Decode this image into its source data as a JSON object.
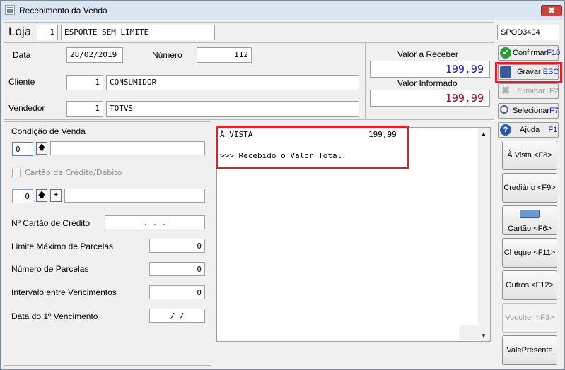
{
  "window": {
    "title": "Recebimento da Venda",
    "close": "✖"
  },
  "loja": {
    "label": "Loja",
    "code": "1",
    "name": "ESPORTE SEM LIMITE"
  },
  "terminal": "SPOD3404",
  "header": {
    "data_label": "Data",
    "data_value": "28/02/2019",
    "numero_label": "Número",
    "numero_value": "112",
    "cliente_label": "Cliente",
    "cliente_code": "1",
    "cliente_name": "CONSUMIDOR",
    "vendedor_label": "Vendedor",
    "vendedor_code": "1",
    "vendedor_name": "TOTVS"
  },
  "values": {
    "receber_label": "Valor a Receber",
    "receber_value": "199,99",
    "informado_label": "Valor Informado",
    "informado_value": "199,99"
  },
  "left": {
    "condicao_label": "Condição de Venda",
    "condicao_code": "0",
    "cartao_label": "Cartão de Crédito/Débito",
    "cartao_code": "0",
    "num_cartao_label": "Nº Cartão de Crédito",
    "num_cartao_value": ".   .   .",
    "limite_label": "Limite Máximo de Parcelas",
    "limite_value": "0",
    "parcelas_label": "Número de Parcelas",
    "parcelas_value": "0",
    "intervalo_label": "Intervalo entre Vencimentos",
    "intervalo_value": "0",
    "vencimento_label": "Data do 1º Vencimento",
    "vencimento_value": "/   /"
  },
  "memo": {
    "line1_label": "À VISTA",
    "line1_value": "199,99",
    "line2": ">>> Recebido o Valor Total."
  },
  "side": {
    "confirmar": "Confirmar",
    "confirmar_key": "F10",
    "gravar": "Gravar",
    "gravar_key": "ESC",
    "eliminar": "Eliminar",
    "eliminar_key": "F2",
    "selecionar": "Selecionar",
    "selecionar_key": "F7",
    "ajuda": "Ajuda",
    "ajuda_key": "F1",
    "avista": "À Vista <F8>",
    "crediario": "Crediário <F9>",
    "cartao": "Cartão <F6>",
    "cheque": "Cheque <F11>",
    "outros": "Outros <F12>",
    "voucher": "Voucher <F3>",
    "vale": "ValePresente"
  },
  "colors": {
    "value_blue": "#1a1aa0",
    "value_red": "#a00020",
    "highlight": "#e0202a"
  }
}
